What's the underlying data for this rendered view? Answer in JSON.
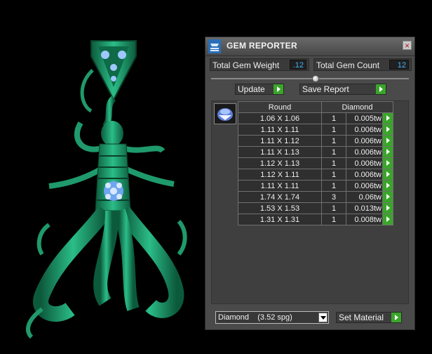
{
  "window": {
    "title": "GEM REPORTER",
    "close_glyph": "×",
    "icon": "gem-reporter-icon"
  },
  "stats": {
    "total_weight_label": "Total Gem Weight",
    "total_weight_value": ".12",
    "total_count_label": "Total Gem Count",
    "total_count_value": "12"
  },
  "actions": {
    "update_label": "Update",
    "save_report_label": "Save Report"
  },
  "table": {
    "headers": {
      "shape": "Round",
      "material": "Diamond"
    },
    "rows": [
      {
        "size": "1.06 X 1.06",
        "qty": "1",
        "weight": "0.005tw"
      },
      {
        "size": "1.11 X 1.11",
        "qty": "1",
        "weight": "0.006tw"
      },
      {
        "size": "1.11 X 1.12",
        "qty": "1",
        "weight": "0.006tw"
      },
      {
        "size": "1.11 X 1.13",
        "qty": "1",
        "weight": "0.006tw"
      },
      {
        "size": "1.12 X 1.13",
        "qty": "1",
        "weight": "0.006tw"
      },
      {
        "size": "1.12 X 1.11",
        "qty": "1",
        "weight": "0.006tw"
      },
      {
        "size": "1.11 X 1.11",
        "qty": "1",
        "weight": "0.006tw"
      },
      {
        "size": "1.74 X 1.74",
        "qty": "3",
        "weight": "0.06tw"
      },
      {
        "size": "1.53 X 1.53",
        "qty": "1",
        "weight": "0.013tw"
      },
      {
        "size": "1.31 X 1.31",
        "qty": "1",
        "weight": "0.008tw"
      }
    ]
  },
  "material_select": {
    "value": "Diamond    (3.52 spg)"
  },
  "set_material_label": "Set Material",
  "colors": {
    "model": "#1f9a6c",
    "gem": "#9ec8ff",
    "accent": "#3aa52a",
    "value_text": "#3fb4ff"
  }
}
